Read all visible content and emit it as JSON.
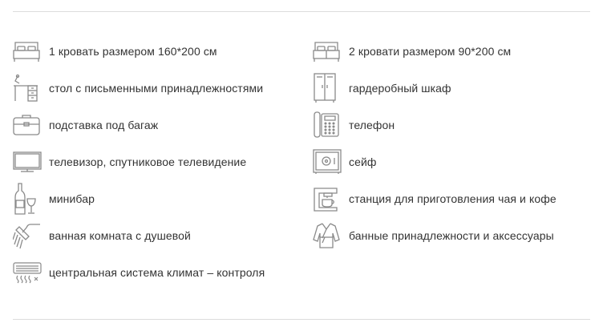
{
  "amenities": {
    "left": [
      {
        "icon": "double-bed-icon",
        "label": "1 кровать размером 160*200 см"
      },
      {
        "icon": "desk-icon",
        "label": "стол с письменными принадлежностями"
      },
      {
        "icon": "luggage-rack-icon",
        "label": "подставка под багаж"
      },
      {
        "icon": "tv-icon",
        "label": "телевизор, спутниковое телевидение"
      },
      {
        "icon": "minibar-icon",
        "label": "минибар"
      },
      {
        "icon": "shower-icon",
        "label": "ванная комната с душевой"
      },
      {
        "icon": "air-conditioner-icon",
        "label": "центральная система климат – контроля"
      }
    ],
    "right": [
      {
        "icon": "twin-beds-icon",
        "label": "2 кровати размером 90*200 см"
      },
      {
        "icon": "wardrobe-icon",
        "label": "гардеробный шкаф"
      },
      {
        "icon": "telephone-icon",
        "label": "телефон"
      },
      {
        "icon": "safe-icon",
        "label": "сейф"
      },
      {
        "icon": "coffee-machine-icon",
        "label": "станция для приготовления чая и кофе"
      },
      {
        "icon": "bathrobe-icon",
        "label": "банные принадлежности и аксессуары"
      }
    ]
  },
  "colors": {
    "icon_stroke": "#8a8a8a",
    "text": "#333333",
    "rule": "#dcdcdc"
  }
}
